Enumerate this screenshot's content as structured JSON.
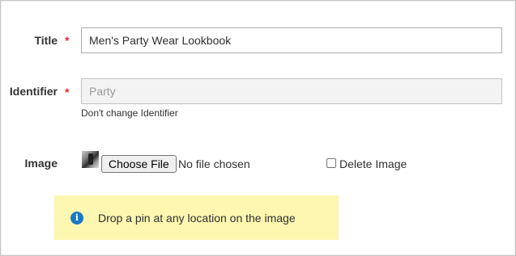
{
  "form": {
    "title": {
      "label": "Title",
      "required_mark": "*",
      "value": "Men's Party Wear Lookbook"
    },
    "identifier": {
      "label": "Identifier",
      "required_mark": "*",
      "value": "Party",
      "note": "Don't change Identifier"
    },
    "image": {
      "label": "Image",
      "choose_button": "Choose File",
      "no_file_text": "No file chosen",
      "delete_label": "Delete Image",
      "delete_checked": false
    }
  },
  "notice": {
    "icon": "info-icon",
    "text": "Drop a pin at any location on the image"
  },
  "colors": {
    "required": "#e02b27",
    "notice_bg": "#fdf7b1",
    "info_icon": "#1979c3"
  }
}
